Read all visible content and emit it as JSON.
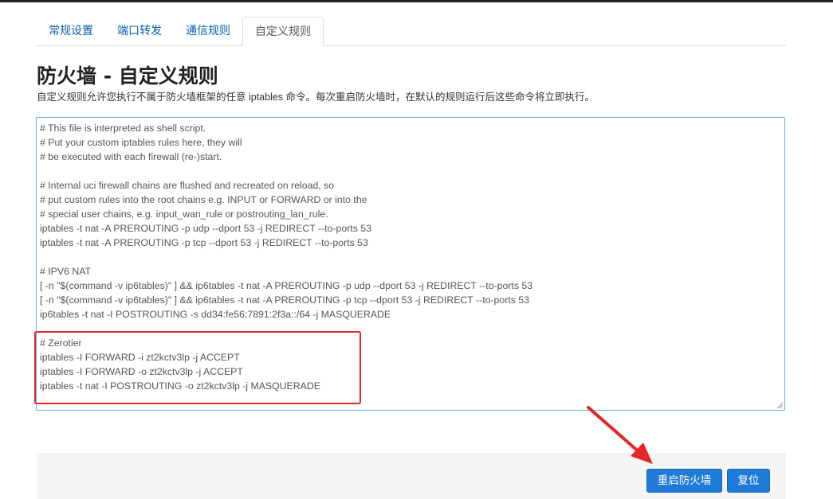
{
  "tabs": [
    {
      "label": "常规设置"
    },
    {
      "label": "端口转发"
    },
    {
      "label": "通信规则"
    },
    {
      "label": "自定义规则"
    }
  ],
  "page": {
    "title": "防火墙 - 自定义规则",
    "description": "自定义规则允许您执行不属于防火墙框架的任意 iptables 命令。每次重启防火墙时，在默认的规则运行后这些命令将立即执行。"
  },
  "editor": {
    "content": "# This file is interpreted as shell script.\n# Put your custom iptables rules here, they will\n# be executed with each firewall (re-)start.\n\n# Internal uci firewall chains are flushed and recreated on reload, so\n# put custom rules into the root chains e.g. INPUT or FORWARD or into the\n# special user chains, e.g. input_wan_rule or postrouting_lan_rule.\niptables -t nat -A PREROUTING -p udp --dport 53 -j REDIRECT --to-ports 53\niptables -t nat -A PREROUTING -p tcp --dport 53 -j REDIRECT --to-ports 53\n\n# IPV6 NAT\n[ -n \"$(command -v ip6tables)\" ] && ip6tables -t nat -A PREROUTING -p udp --dport 53 -j REDIRECT --to-ports 53\n[ -n \"$(command -v ip6tables)\" ] && ip6tables -t nat -A PREROUTING -p tcp --dport 53 -j REDIRECT --to-ports 53\nip6tables -t nat -I POSTROUTING -s dd34:fe56:7891:2f3a::/64 -j MASQUERADE\n\n# Zerotier\niptables -I FORWARD -i zt2kctv3lp -j ACCEPT\niptables -I FORWARD -o zt2kctv3lp -j ACCEPT\niptables -t nat -I POSTROUTING -o zt2kctv3lp -j MASQUERADE"
  },
  "buttons": {
    "restart_label": "重启防火墙",
    "reset_label": "复位"
  },
  "colors": {
    "accent": "#1e7bd8",
    "annotation": "#e3262a",
    "link": "#0a5fb0"
  }
}
